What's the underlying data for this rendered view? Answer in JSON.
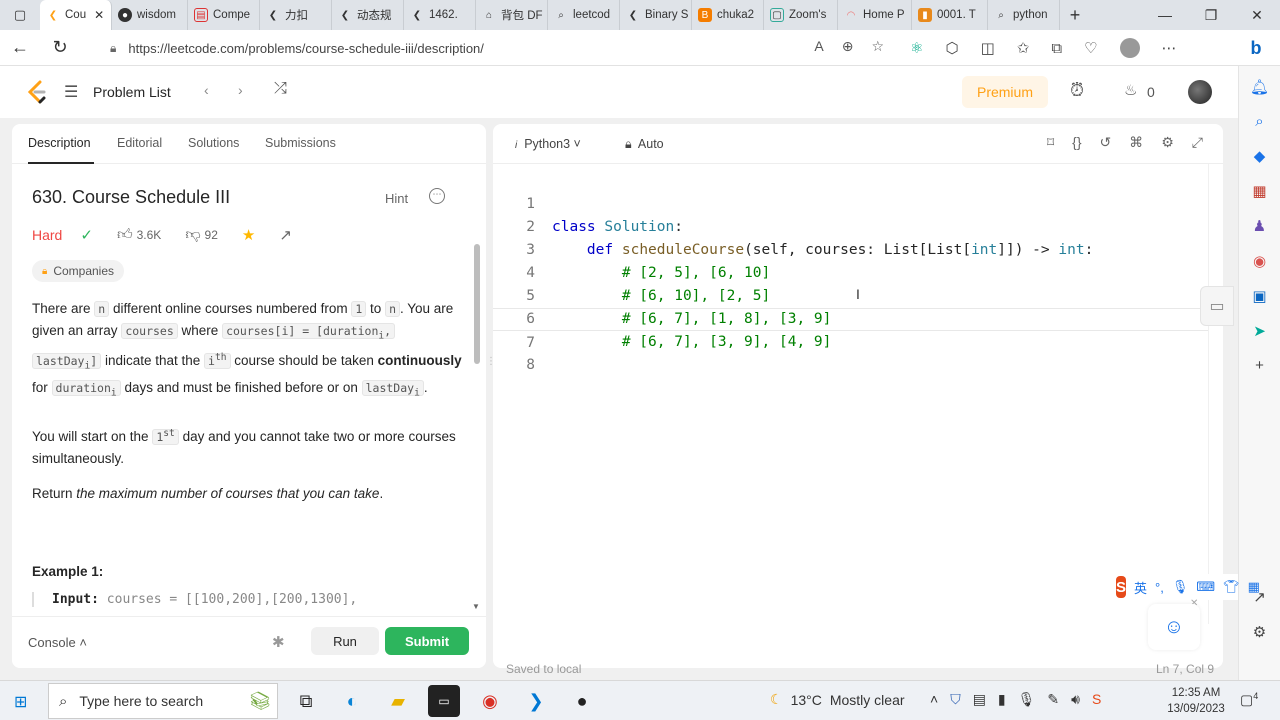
{
  "browser": {
    "tabs": [
      {
        "label": "Cou",
        "active": true
      },
      {
        "label": "wisdom"
      },
      {
        "label": "Compe"
      },
      {
        "label": "力扣"
      },
      {
        "label": "动态规"
      },
      {
        "label": "1462."
      },
      {
        "label": "背包 DF"
      },
      {
        "label": "leetcod"
      },
      {
        "label": "Binary S"
      },
      {
        "label": "chuka2"
      },
      {
        "label": "Zoom's"
      },
      {
        "label": "Home P"
      },
      {
        "label": "0001. T"
      },
      {
        "label": "python"
      }
    ],
    "url": "https://leetcode.com/problems/course-schedule-iii/description/"
  },
  "lc_header": {
    "problem_list": "Problem List",
    "premium": "Premium",
    "streak_count": "0"
  },
  "left": {
    "tabs": [
      "Description",
      "Editorial",
      "Solutions",
      "Submissions"
    ],
    "title": "630. Course Schedule III",
    "hint": "Hint",
    "difficulty": "Hard",
    "likes": "3.6K",
    "dislikes": "92",
    "companies": "Companies",
    "p1": {
      "a": "There are ",
      "n": "n",
      "b": " different online courses numbered from ",
      "one": "1",
      "c": " to ",
      "n2": "n",
      "d": ". You are given an array ",
      "courses": "courses",
      "e": " where ",
      "arr": "courses[i] = [duration",
      "sub_i": "i",
      "arr2": ",",
      "last": "lastDay",
      "sub_i2": "i",
      "last2": "]",
      "f": " indicate that the ",
      "ith": "i",
      "th": "th",
      "g": " course should be taken ",
      "bold": "continuously",
      "h": " for ",
      "dur": "duration",
      "sub_i3": "i",
      "i": " days and must be finished before or on ",
      "lastday": "lastDay",
      "sub_i4": "i",
      "j": "."
    },
    "p2": {
      "a": "You will start on the ",
      "first": "1",
      "st": "st",
      "b": " day and you cannot take two or more courses simultaneously."
    },
    "p3": {
      "a": "Return ",
      "em": "the maximum number of courses that you can take",
      "b": "."
    },
    "example_title": "Example 1:",
    "example_input_label": "Input:",
    "example_input_value": " courses = [[100,200],[200,1300],"
  },
  "console": {
    "label": "Console",
    "run": "Run",
    "submit": "Submit"
  },
  "editor": {
    "language": "Python3",
    "mode": "Auto",
    "lines": [
      {
        "n": "1"
      },
      {
        "n": "2"
      },
      {
        "n": "3",
        "text": "# [2, 5], [6, 10]"
      },
      {
        "n": "4",
        "text": "# [6, 10], [2, 5]"
      },
      {
        "n": "5",
        "text": "# [6, 7], [1, 8], [3, 9]"
      },
      {
        "n": "6",
        "text": "# [6, 7], [3, 9], [4, 9]"
      },
      {
        "n": "7"
      },
      {
        "n": "8"
      }
    ],
    "line1": {
      "kw": "class",
      "cls": "Solution",
      "colon": ":"
    },
    "line2": {
      "kw": "def",
      "fn": "scheduleCourse",
      "a": "(self, courses: List[List[",
      "ty": "int",
      "b": "]]) -> ",
      "ret": "int",
      "c": ":"
    },
    "saved": "Saved to local",
    "position": "Ln 7, Col 9"
  },
  "taskbar": {
    "search": "Type here to search",
    "temp": "13°C",
    "weather": "Mostly clear",
    "time": "12:35 AM",
    "date": "13/09/2023",
    "notif_count": "4"
  },
  "ime": {
    "lang": "英"
  }
}
